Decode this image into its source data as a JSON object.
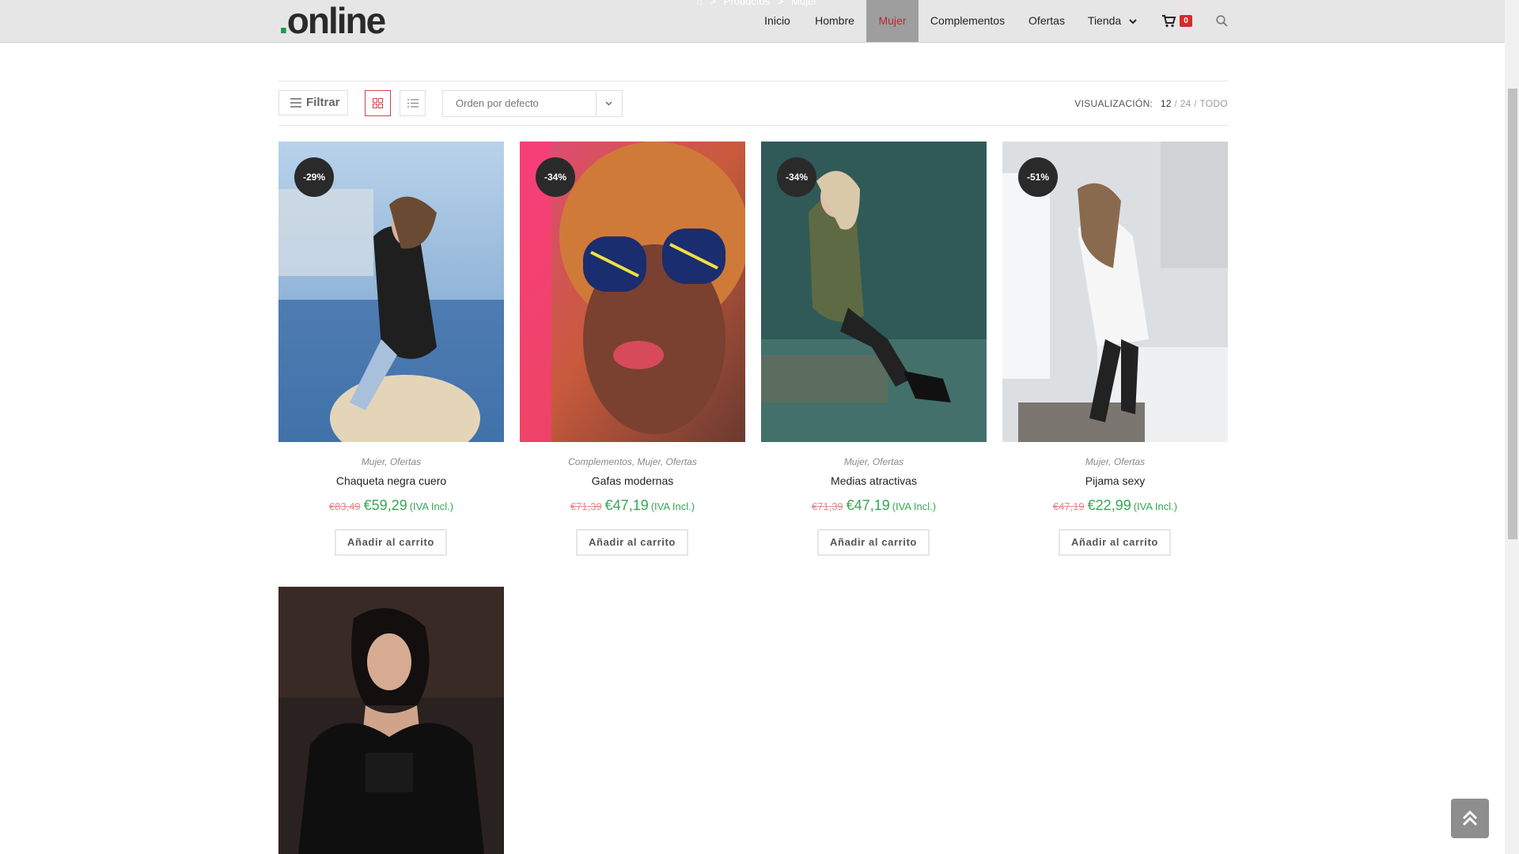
{
  "brand": {
    "dot": ".",
    "name": "online"
  },
  "breadcrumb": {
    "home_icon": "home-icon",
    "separator": ">",
    "level1": "Productos",
    "level2": "Mujer"
  },
  "nav": {
    "items": [
      {
        "label": "Inicio"
      },
      {
        "label": "Hombre"
      },
      {
        "label": "Mujer",
        "active": true
      },
      {
        "label": "Complementos"
      },
      {
        "label": "Ofertas"
      },
      {
        "label": "Tienda"
      }
    ],
    "cart_count": "0"
  },
  "toolbar": {
    "filter_label": "Filtrar",
    "sort_value": "Orden por defecto",
    "view_label": "VISUALIZACIÓN:",
    "view_options": {
      "current": "12",
      "sep1": "/",
      "opt2": "24",
      "sep2": "/",
      "opt3": "TODO"
    }
  },
  "products": [
    {
      "badge": "-29%",
      "cats": "Mujer, Ofertas",
      "title": "Chaqueta negra cuero",
      "old_price": "€83,49",
      "price": "€59,29",
      "tax": "(IVA Incl.)",
      "button": "Añadir al carrito"
    },
    {
      "badge": "-34%",
      "cats": "Complementos, Mujer, Ofertas",
      "title": "Gafas modernas",
      "old_price": "€71,39",
      "price": "€47,19",
      "tax": "(IVA Incl.)",
      "button": "Añadir al carrito"
    },
    {
      "badge": "-34%",
      "cats": "Mujer, Ofertas",
      "title": "Medias atractivas",
      "old_price": "€71,39",
      "price": "€47,19",
      "tax": "(IVA Incl.)",
      "button": "Añadir al carrito"
    },
    {
      "badge": "-51%",
      "cats": "Mujer, Ofertas",
      "title": "Pijama sexy",
      "old_price": "€47,19",
      "price": "€22,99",
      "tax": "(IVA Incl.)",
      "button": "Añadir al carrito"
    }
  ],
  "colors": {
    "accent": "#c0272d",
    "price_green": "#34a853",
    "badge_bg": "#2a2a2a"
  }
}
